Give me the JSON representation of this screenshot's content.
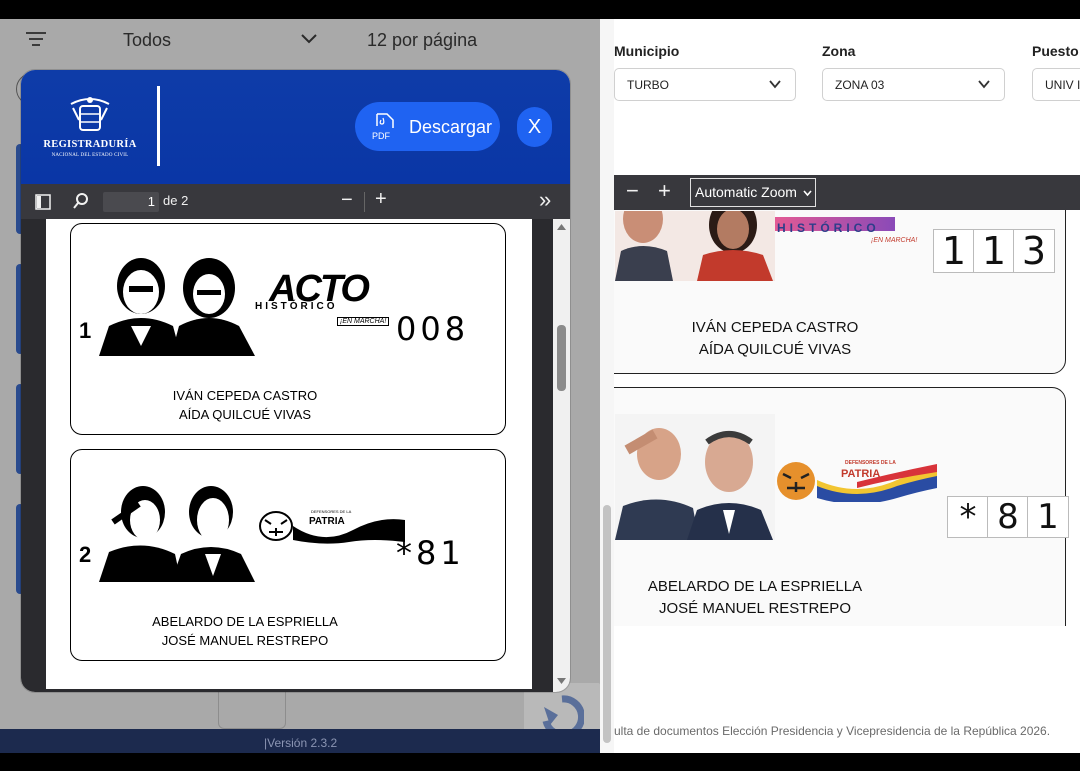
{
  "left": {
    "filter_label": "Todos",
    "per_page_label": "12 por página",
    "version": "|Versión 2.3.2"
  },
  "modal": {
    "logo_text": "REGISTRADURÍA",
    "logo_sub": "NACIONAL DEL ESTADO CIVIL",
    "pdf_badge": "PDF",
    "download_label": "Descargar",
    "close_label": "X",
    "viewer": {
      "page_number": "1",
      "page_total": "de 2",
      "zoom_out": "−",
      "zoom_in": "+",
      "more": "»"
    },
    "ballots": [
      {
        "number": "1",
        "party_logo": "ACTO",
        "party_sub": "HISTÓRICO",
        "party_tag": "¡EN MARCHA!",
        "votes": "008",
        "candidate_1": "IVÁN CEPEDA CASTRO",
        "candidate_2": "AÍDA QUILCUÉ VIVAS"
      },
      {
        "number": "2",
        "party_logo": "PATRIA",
        "party_sub": "DEFENSORES DE LA",
        "party_tag": "",
        "votes": "*81",
        "candidate_1": "ABELARDO DE LA ESPRIELLA",
        "candidate_2": "JOSÉ MANUEL RESTREPO"
      }
    ]
  },
  "right": {
    "filters": [
      {
        "label": "Municipio",
        "value": "TURBO"
      },
      {
        "label": "Zona",
        "value": "ZONA 03"
      },
      {
        "label": "Puesto",
        "value": "UNIV I"
      }
    ],
    "viewer": {
      "zoom_out": "−",
      "zoom_in": "+",
      "zoom_value": "Automatic Zoom"
    },
    "ballots": [
      {
        "party_sub": "HISTÓRICO",
        "party_tag": "¡EN MARCHA!",
        "digits": [
          "1",
          "1",
          "3"
        ],
        "candidate_1": "IVÁN CEPEDA CASTRO",
        "candidate_2": "AÍDA QUILCUÉ VIVAS"
      },
      {
        "party_logo": "PATRIA",
        "party_sub": "DEFENSORES DE LA",
        "digits": [
          "*",
          "8",
          "1"
        ],
        "candidate_1": "ABELARDO DE LA ESPRIELLA",
        "candidate_2": "JOSÉ MANUEL RESTREPO"
      }
    ],
    "footer": "ulta de documentos Elección Presidencia y Vicepresidencia de la República 2026."
  }
}
